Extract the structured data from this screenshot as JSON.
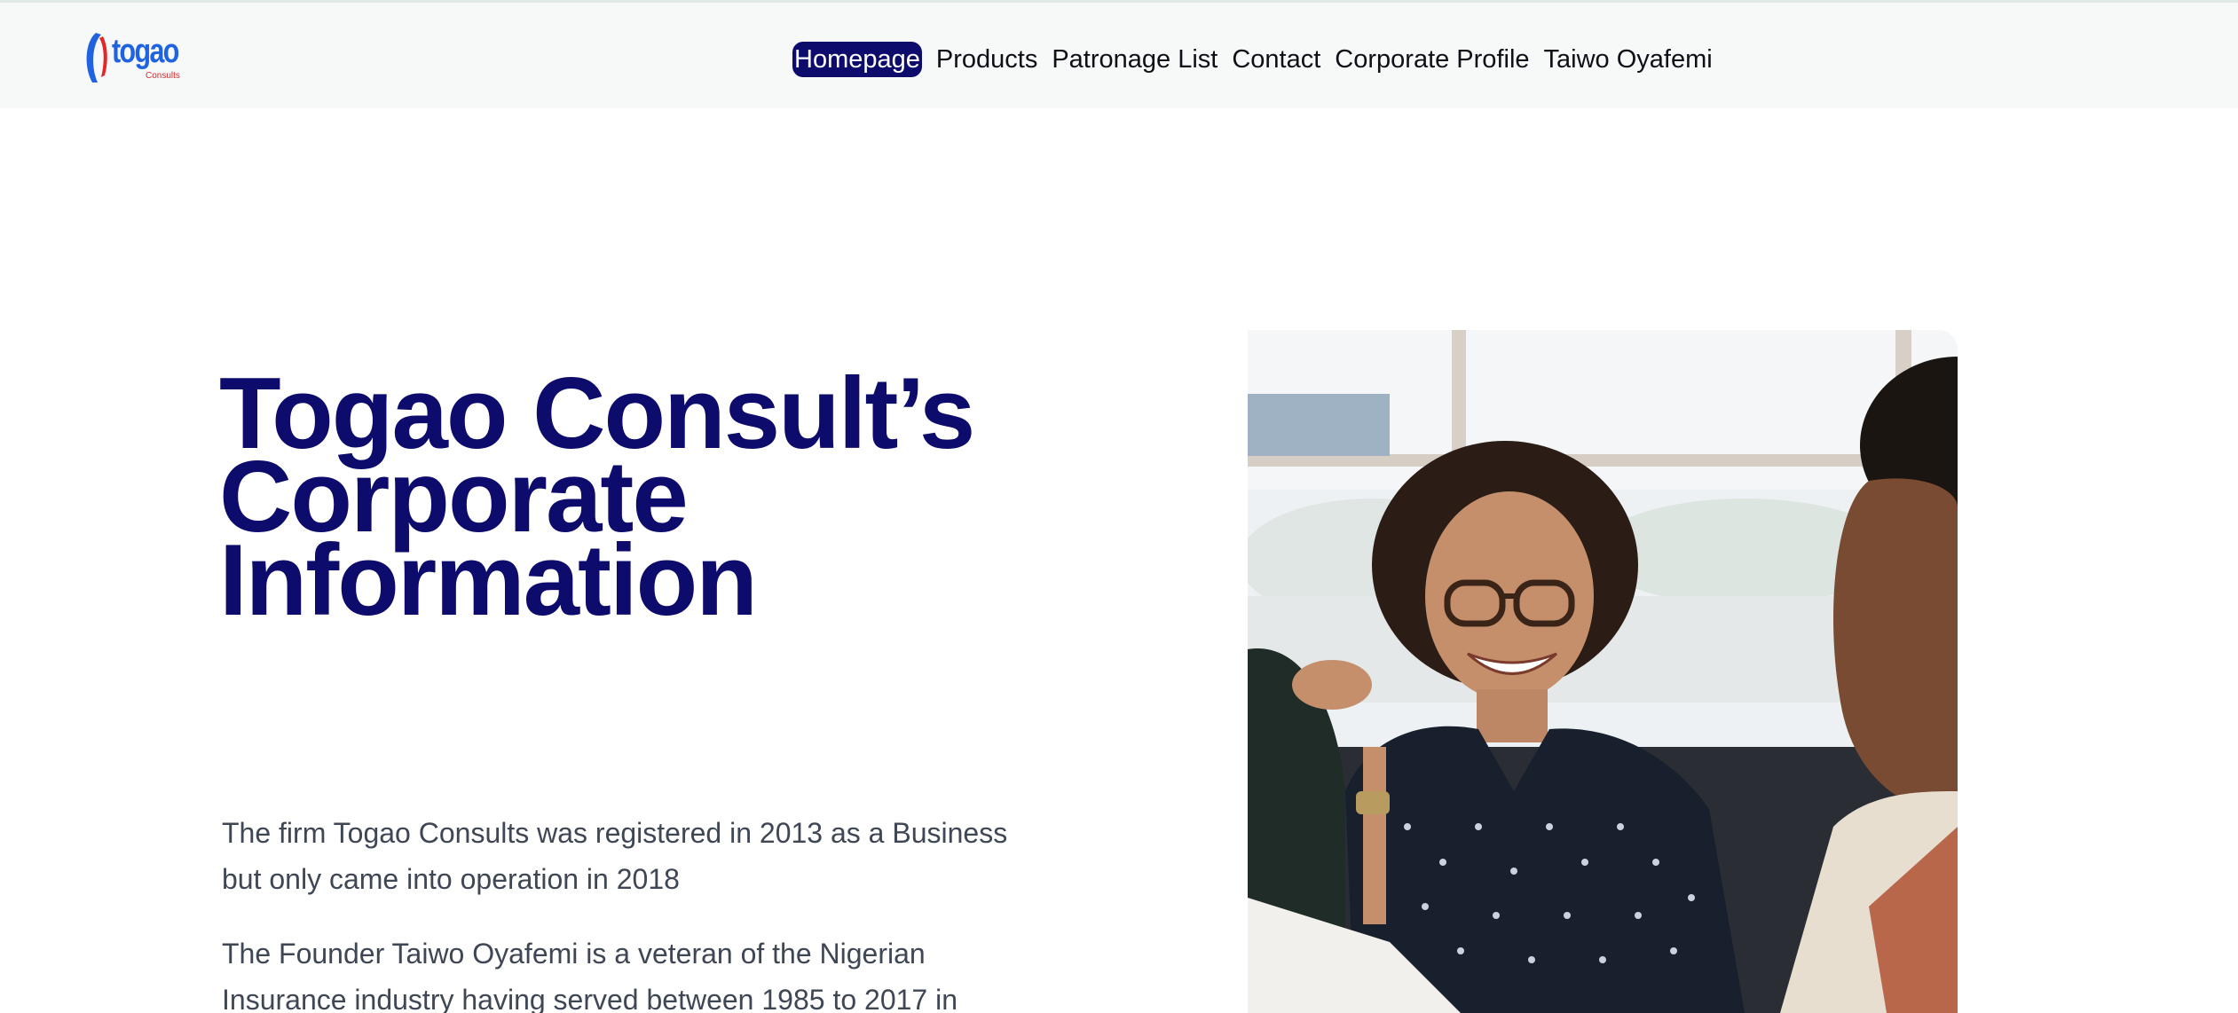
{
  "header": {
    "logo": {
      "word": "togao",
      "sub": "Consults",
      "colors": {
        "blue": "#1f63e0",
        "red": "#e3262a"
      }
    },
    "nav": [
      {
        "label": "Homepage",
        "active": true
      },
      {
        "label": "Products",
        "active": false
      },
      {
        "label": "Patronage List",
        "active": false
      },
      {
        "label": "Contact",
        "active": false
      },
      {
        "label": "Corporate Profile",
        "active": false
      },
      {
        "label": "Taiwo Oyafemi",
        "active": false
      }
    ]
  },
  "hero": {
    "title_lines": [
      "Togao Consult’s",
      "Corporate",
      "Information"
    ],
    "paragraphs": [
      "The firm Togao Consults was registered in 2013 as a Business but only came into operation in 2018",
      "The Founder Taiwo Oyafemi is a veteran of the Nigerian Insurance industry having served between 1985 to 2017 in"
    ]
  },
  "colors": {
    "brand_navy": "#0d0b6b",
    "body_text": "#3f4654",
    "header_bg": "#f7f8f8"
  }
}
